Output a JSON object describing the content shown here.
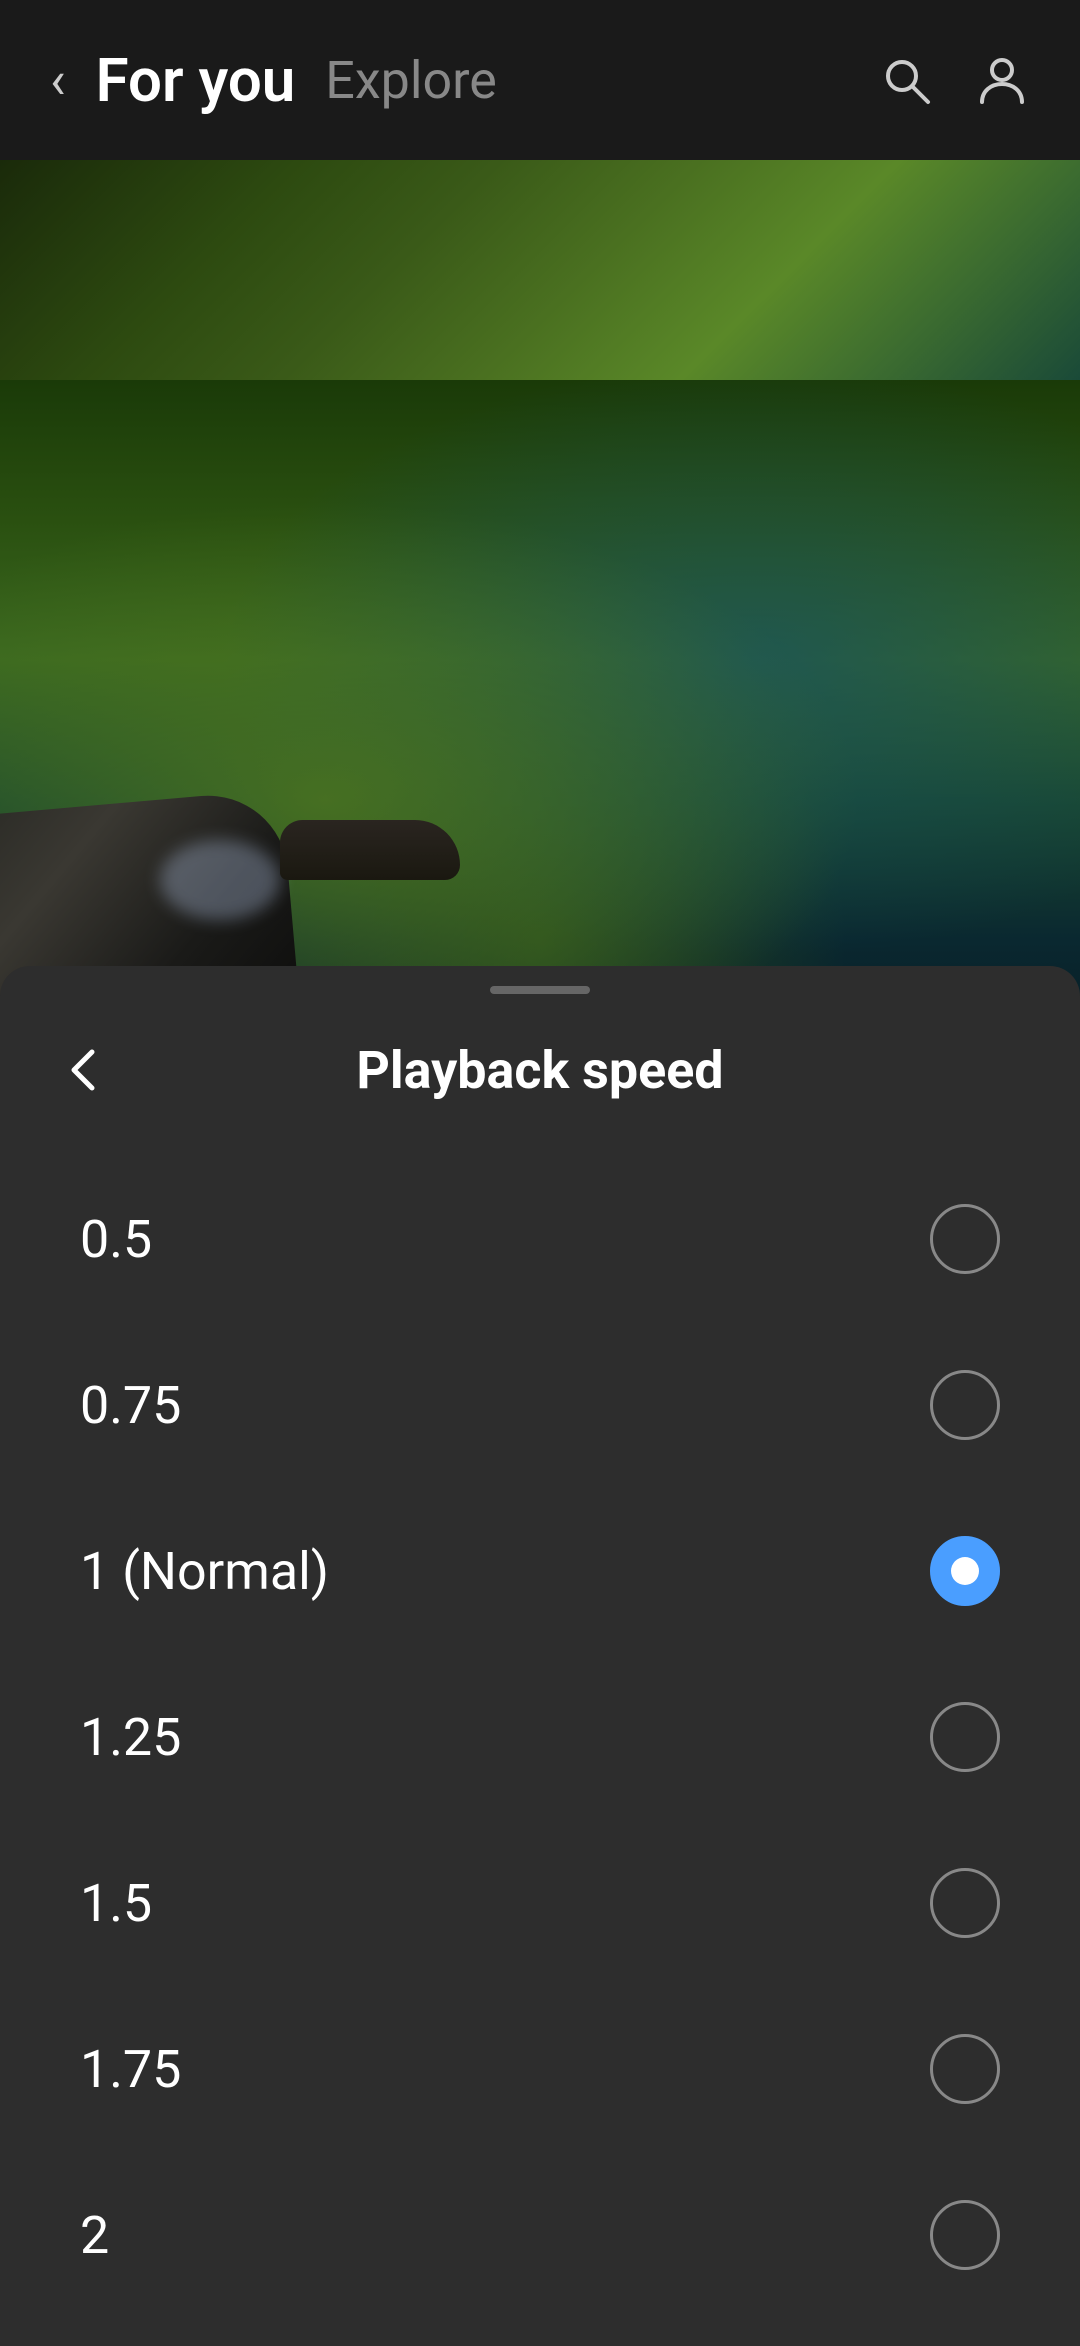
{
  "header": {
    "back_label": "‹",
    "for_you_label": "For you",
    "explore_label": "Explore",
    "search_icon": "search",
    "profile_icon": "person"
  },
  "bottom_sheet": {
    "handle": true,
    "back_label": "←",
    "title": "Playback speed",
    "speed_options": [
      {
        "id": "speed-0.5",
        "label": "0.5",
        "selected": false
      },
      {
        "id": "speed-0.75",
        "label": "0.75",
        "selected": false
      },
      {
        "id": "speed-1",
        "label": "1 (Normal)",
        "selected": true
      },
      {
        "id": "speed-1.25",
        "label": "1.25",
        "selected": false
      },
      {
        "id": "speed-1.5",
        "label": "1.5",
        "selected": false
      },
      {
        "id": "speed-1.75",
        "label": "1.75",
        "selected": false
      },
      {
        "id": "speed-2",
        "label": "2",
        "selected": false
      }
    ]
  },
  "colors": {
    "background": "#1a1a1a",
    "sheet_bg": "#2d2d2d",
    "text_primary": "#ffffff",
    "text_secondary": "#888888",
    "accent_blue": "#4a9eff",
    "radio_border": "#888888",
    "nav_active": "#ffffff",
    "nav_inactive": "#888888"
  }
}
